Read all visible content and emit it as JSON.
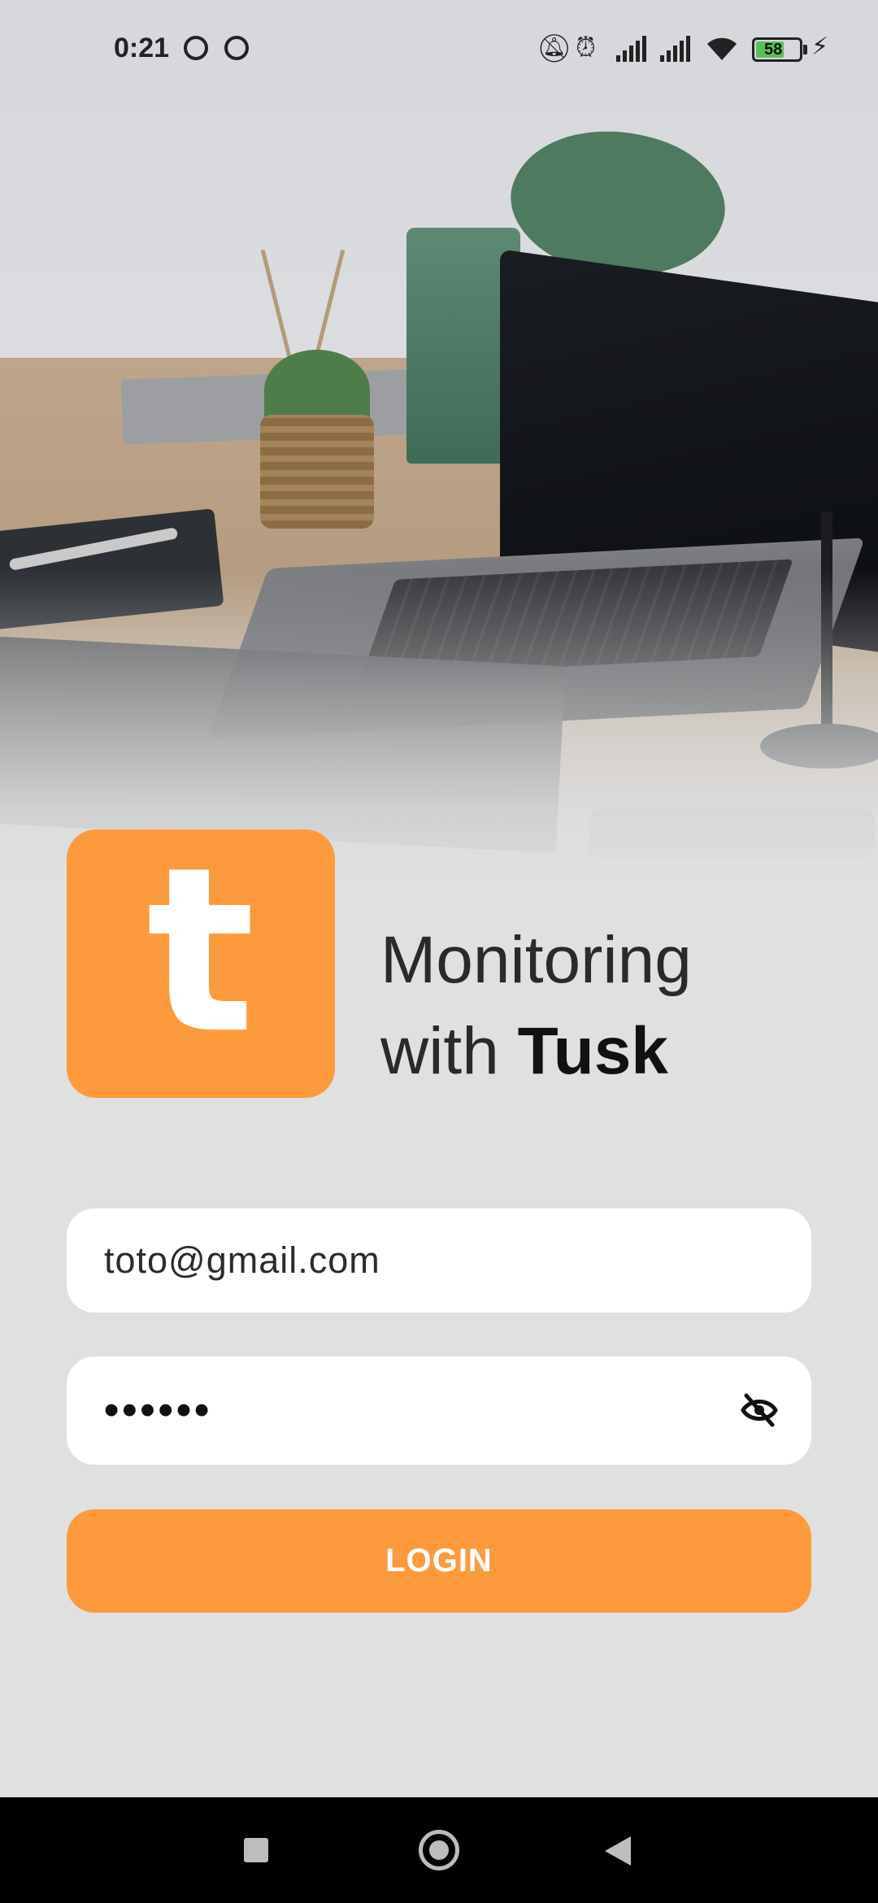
{
  "status_bar": {
    "time": "0:21",
    "battery_level": "58",
    "icons": [
      "dnd-icon",
      "dnd-icon",
      "bell-off-icon",
      "alarm-icon",
      "signal-icon",
      "signal-icon",
      "wifi-icon",
      "battery-icon",
      "charging-icon"
    ]
  },
  "hero": {
    "image": "desk-with-laptop-photo"
  },
  "branding": {
    "logo_letter": "t",
    "tagline_line1": "Monitoring",
    "tagline_prefix": "with ",
    "brand_name": "Tusk",
    "accent_color": "#fd9a3e"
  },
  "form": {
    "email_value": "toto@gmail.com",
    "password_masked": "••••••",
    "password_toggle_icon": "eye-off-icon",
    "login_label": "LOGIN"
  },
  "nav_bar": {
    "icons": [
      "recents-icon",
      "home-icon",
      "back-icon"
    ]
  }
}
